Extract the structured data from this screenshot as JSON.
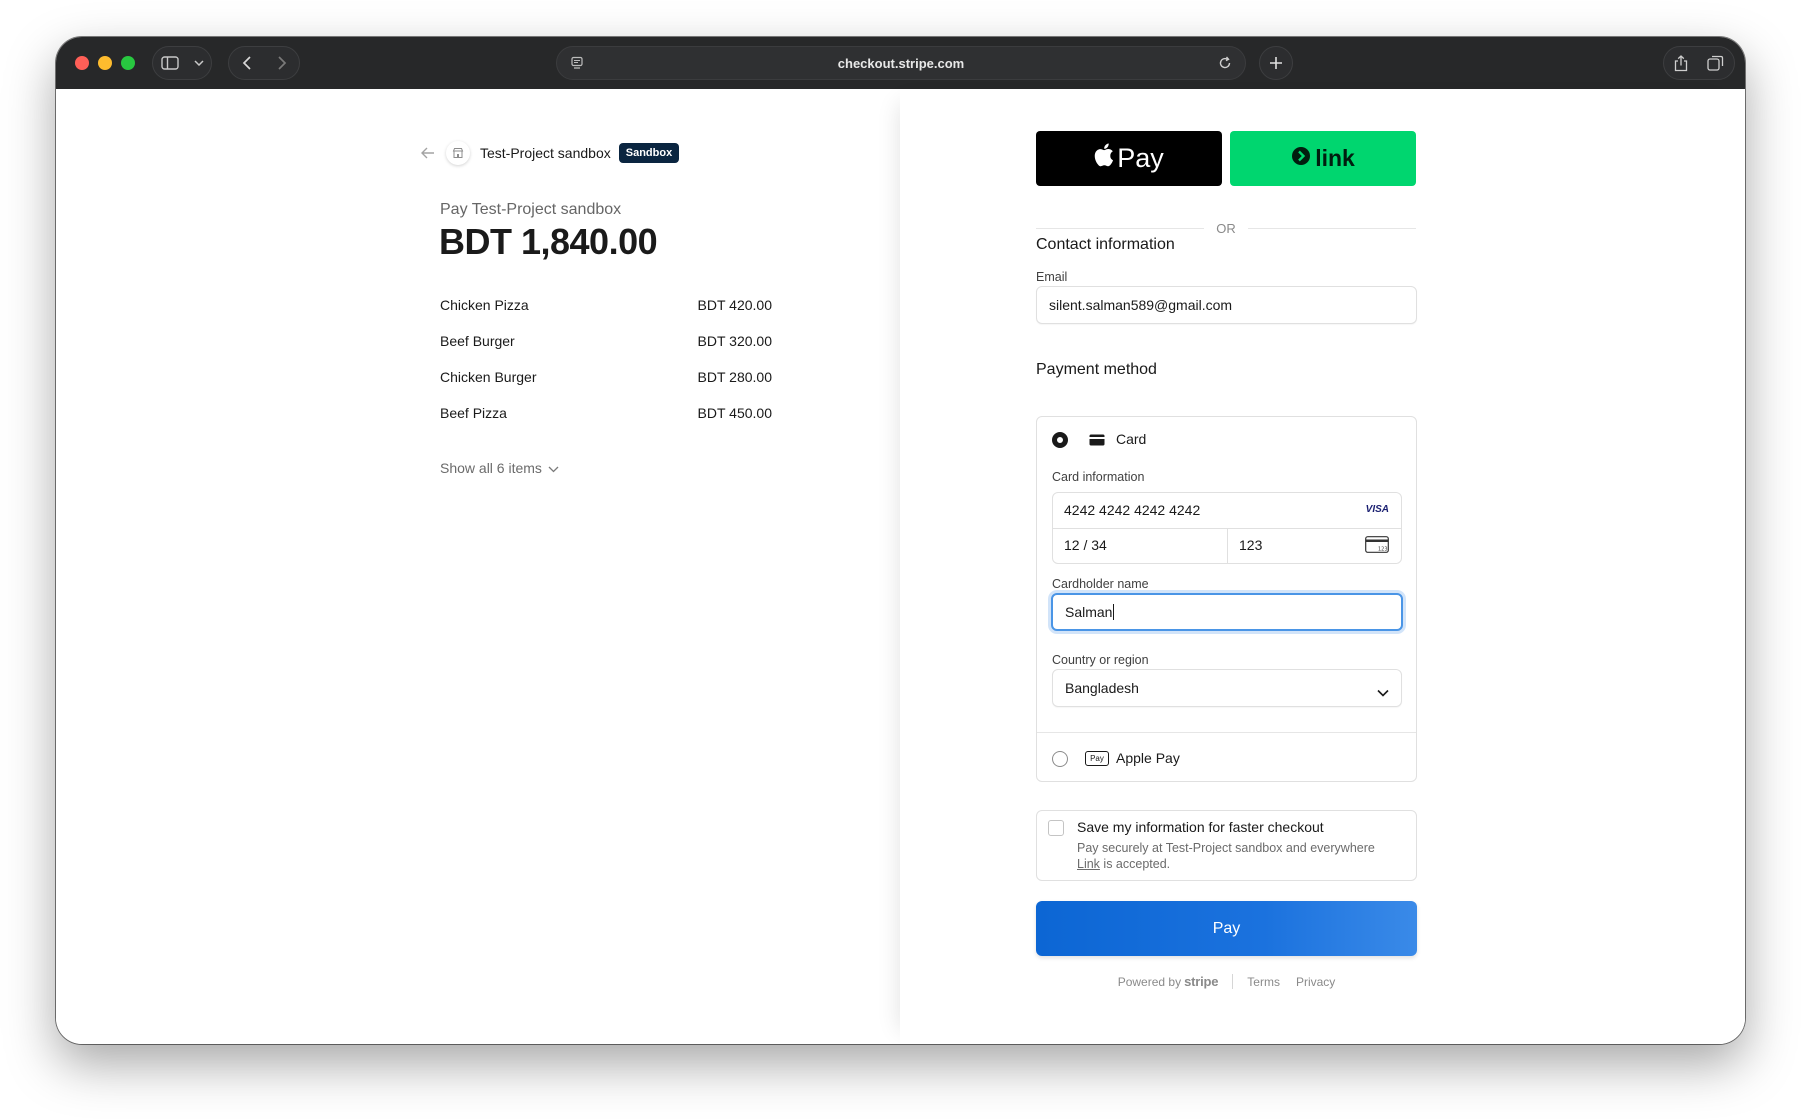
{
  "browser": {
    "url": "checkout.stripe.com"
  },
  "merchant": {
    "name": "Test-Project sandbox",
    "badge": "Sandbox"
  },
  "summary": {
    "pay_label": "Pay Test-Project sandbox",
    "total": "BDT 1,840.00",
    "items": [
      {
        "name": "Chicken Pizza",
        "price": "BDT 420.00"
      },
      {
        "name": "Beef Burger",
        "price": "BDT 320.00"
      },
      {
        "name": "Chicken Burger",
        "price": "BDT 280.00"
      },
      {
        "name": "Beef Pizza",
        "price": "BDT 450.00"
      }
    ],
    "show_all": "Show all 6 items"
  },
  "wallets": {
    "apple_pay": "Pay",
    "link": "link",
    "or": "OR"
  },
  "contact": {
    "title": "Contact information",
    "email_label": "Email",
    "email_value": "silent.salman589@gmail.com"
  },
  "payment": {
    "title": "Payment method",
    "card_option": "Card",
    "card_info_label": "Card information",
    "card_number": "4242 4242 4242 4242",
    "card_brand": "VISA",
    "expiry": "12 / 34",
    "cvc": "123",
    "cardholder_label": "Cardholder name",
    "cardholder_value": "Salman",
    "country_label": "Country or region",
    "country_value": "Bangladesh",
    "apple_pay_option": "Apple Pay",
    "apple_pay_mark": "Pay"
  },
  "save_info": {
    "title": "Save my information for faster checkout",
    "desc_line1": "Pay securely at Test-Project sandbox and everywhere",
    "link_word": "Link",
    "desc_line2_rest": "is accepted."
  },
  "pay_button": "Pay",
  "footer": {
    "powered_by": "Powered by",
    "brand": "stripe",
    "terms": "Terms",
    "privacy": "Privacy"
  },
  "colors": {
    "accent": "#0c66d4",
    "link_green": "#00d66f",
    "sandbox_badge": "#0a2540",
    "focus_ring": "#4a95e6"
  }
}
